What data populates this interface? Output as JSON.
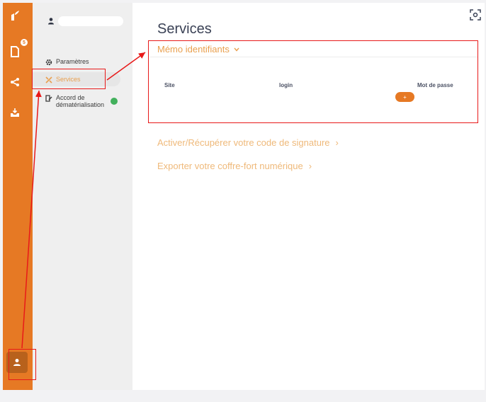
{
  "sidebar": {
    "badge_count": "5",
    "icons": [
      "brand-logo-icon",
      "document-icon",
      "share-icon",
      "inbox-icon",
      "user-icon"
    ]
  },
  "subnav": {
    "items": [
      {
        "label": "Paramètres",
        "icon": "gear-icon"
      },
      {
        "label": "Services",
        "icon": "services-icon",
        "active": true
      },
      {
        "label_line1": "Accord de",
        "label_line2": "dématérialisation",
        "icon": "edit-document-icon",
        "status_color": "#42b05c"
      }
    ]
  },
  "main": {
    "title": "Services",
    "memo": {
      "title": "Mémo identifiants",
      "columns": [
        "Site",
        "login",
        "Mot de passe"
      ],
      "add_label": "+"
    },
    "links": [
      {
        "label": "Activer/Récupérer votre code de signature",
        "chevron": "›"
      },
      {
        "label": "Exporter votre coffre-fort numérique",
        "chevron": "›"
      }
    ]
  },
  "colors": {
    "accent": "#e67924",
    "link": "#e9a04f",
    "annotation": "#e81919"
  }
}
